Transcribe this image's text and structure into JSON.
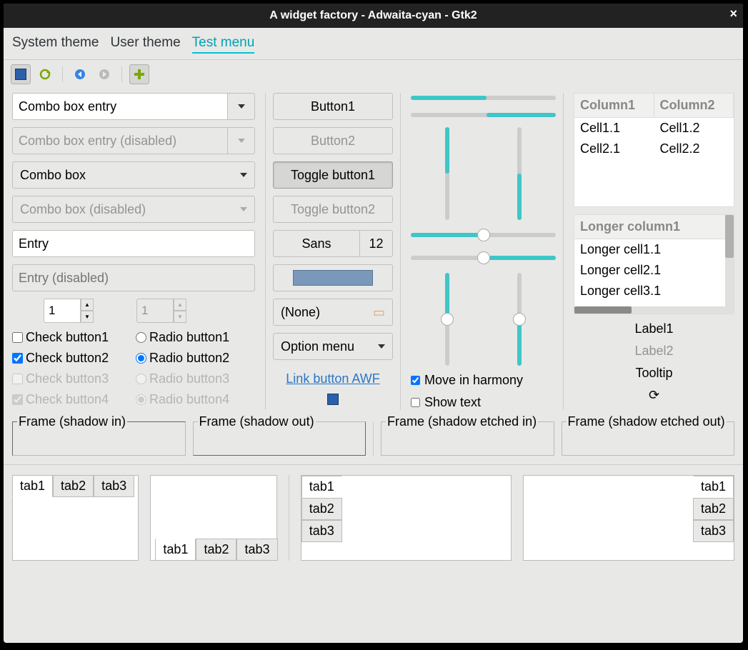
{
  "title": "A widget factory - Adwaita-cyan - Gtk2",
  "menubar": {
    "system": "System theme",
    "user": "User theme",
    "test": "Test menu"
  },
  "col1": {
    "combo_entry": "Combo box entry",
    "combo_entry_disabled": "Combo box entry (disabled)",
    "combo_box": "Combo box",
    "combo_box_disabled": "Combo box (disabled)",
    "entry": "Entry",
    "entry_disabled_ph": "Entry (disabled)",
    "spin1": "1",
    "spin2": "1",
    "check1": "Check button1",
    "check2": "Check button2",
    "check3": "Check button3",
    "check4": "Check button4",
    "radio1": "Radio button1",
    "radio2": "Radio button2",
    "radio3": "Radio button3",
    "radio4": "Radio button4"
  },
  "col2": {
    "button1": "Button1",
    "button2": "Button2",
    "toggle1": "Toggle button1",
    "toggle2": "Toggle button2",
    "font_name": "Sans",
    "font_size": "12",
    "file_none": "(None)",
    "option_menu": "Option menu",
    "link": "Link button AWF"
  },
  "col3": {
    "harmony": "Move in harmony",
    "show_text": "Show text"
  },
  "col4": {
    "table1": {
      "col1": "Column1",
      "col2": "Column2",
      "r1c1": "Cell1.1",
      "r1c2": "Cell1.2",
      "r2c1": "Cell2.1",
      "r2c2": "Cell2.2"
    },
    "table2": {
      "col1": "Longer column1",
      "r1": "Longer cell1.1",
      "r2": "Longer cell2.1",
      "r3": "Longer cell3.1"
    },
    "label1": "Label1",
    "label2": "Label2",
    "tooltip": "Tooltip"
  },
  "frames": {
    "in": "Frame (shadow in)",
    "out": "Frame (shadow out)",
    "etched_in": "Frame (shadow etched in)",
    "etched_out": "Frame (shadow etched out)"
  },
  "tabs": {
    "t1": "tab1",
    "t2": "tab2",
    "t3": "tab3"
  }
}
